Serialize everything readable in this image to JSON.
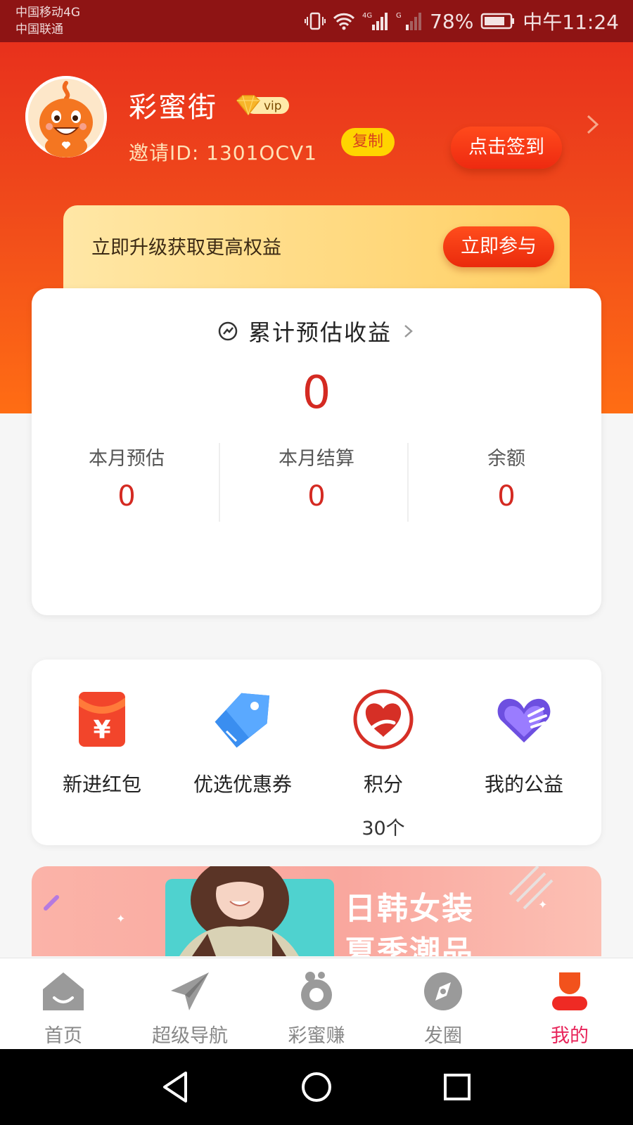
{
  "status_bar": {
    "carrier_1": "中国移动4G",
    "carrier_2": "中国联通",
    "battery": "78%",
    "time": "中午11:24"
  },
  "profile": {
    "username": "彩蜜街",
    "vip_label": "vip",
    "invite_id": "邀请ID: 1301OCV1",
    "copy_label": "复制",
    "signin_label": "点击签到"
  },
  "upgrade": {
    "text": "立即升级获取更高权益",
    "button_label": "立即参与"
  },
  "earnings": {
    "title": "累计预估收益",
    "total": "0",
    "stats": [
      {
        "label": "本月预估",
        "value": "0"
      },
      {
        "label": "本月结算",
        "value": "0"
      },
      {
        "label": "余额",
        "value": "0"
      }
    ]
  },
  "menu": {
    "items": [
      {
        "label": "新进红包",
        "icon": "red-envelope-icon"
      },
      {
        "label": "优选优惠券",
        "icon": "coupon-tag-icon"
      },
      {
        "label": "积分",
        "sub": "30个",
        "icon": "points-icon"
      },
      {
        "label": "我的公益",
        "icon": "charity-hands-icon"
      }
    ]
  },
  "promo": {
    "line1": "日韩女装",
    "line2": "夏季潮品"
  },
  "tabs": [
    {
      "label": "首页",
      "icon": "home-icon",
      "active": false
    },
    {
      "label": "超级导航",
      "icon": "paper-plane-icon",
      "active": false
    },
    {
      "label": "彩蜜赚",
      "icon": "earn-icon",
      "active": false
    },
    {
      "label": "发圈",
      "icon": "compass-icon",
      "active": false
    },
    {
      "label": "我的",
      "icon": "profile-icon",
      "active": true
    }
  ],
  "colors": {
    "accent_red": "#d42a22",
    "header_red": "#e8311c",
    "active_tab": "#e8245a"
  }
}
